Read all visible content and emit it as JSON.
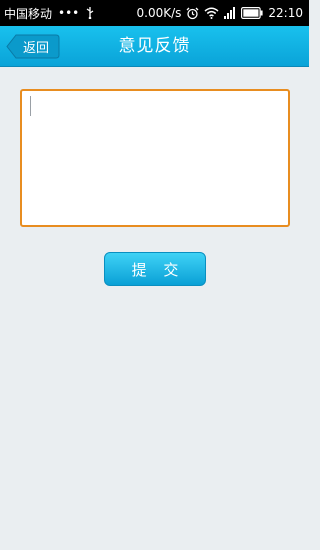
{
  "status_bar": {
    "carrier": "中国移动",
    "dots": "•••",
    "network_speed": "0.00K/s",
    "time": "22:10"
  },
  "header": {
    "back_label": "返回",
    "title": "意见反馈"
  },
  "form": {
    "feedback_value": "",
    "submit_label": "提 交"
  },
  "colors": {
    "header_bg": "#12b4e6",
    "input_border": "#e88d20",
    "page_bg": "#eaeef1",
    "button_bg": "#1ab8ea"
  }
}
